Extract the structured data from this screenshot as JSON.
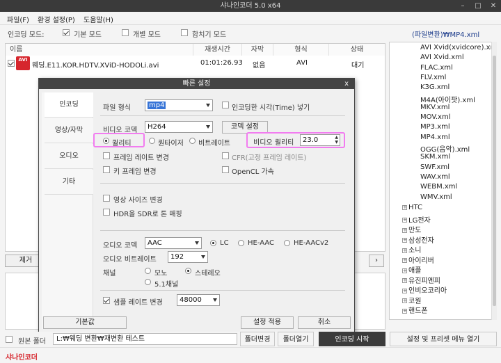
{
  "window": {
    "title": "샤나인코더  5.0 x64"
  },
  "menu": {
    "file": "파일(F)",
    "settings": "환경 설정(P)",
    "help": "도움말(H)"
  },
  "modes": {
    "label": "인코딩 모드:",
    "basic": "기본 모드",
    "individual": "개별 모드",
    "merge": "합치기 모드"
  },
  "preset_path": "(파일변환)₩MP4.xml",
  "filelist": {
    "headers": {
      "name": "이름",
      "duration": "재생시간",
      "subtitle": "자막",
      "format": "형식",
      "status": "상태"
    },
    "rows": [
      {
        "name": "웨딩.E11.KOR.HDTV.XViD-HODOLi.avi",
        "duration": "01:01:26.93",
        "subtitle": "없음",
        "format": "AVI",
        "status": "대기",
        "icon": "AVI"
      }
    ]
  },
  "remove_button": "제거",
  "tree": {
    "files": [
      "AVI Xvid(xvidcore).xml",
      "AVI Xvid.xml",
      "FLAC.xml",
      "FLV.xml",
      "K3G.xml",
      "M4A(아이팟).xml",
      "MKV.xml",
      "MOV.xml",
      "MP3.xml",
      "MP4.xml",
      "OGG(음악).xml",
      "SKM.xml",
      "SWF.xml",
      "WAV.xml",
      "WEBM.xml",
      "WMV.xml"
    ],
    "folders": [
      "HTC",
      "LG전자",
      "만도",
      "삼성전자",
      "소니",
      "아이리버",
      "애플",
      "유진피엔피",
      "인비오코리아",
      "코원",
      "핸드폰"
    ]
  },
  "dialog": {
    "title": "빠른 설정",
    "close": "x",
    "tabs": [
      "인코딩",
      "영상/자막",
      "오디오",
      "기타"
    ],
    "file_format_label": "파일 형식",
    "file_format": "mp4",
    "encoded_time_check": "인코딩한 시각(Time) 넣기",
    "video_codec_label": "비디오 코덱",
    "video_codec": "H264",
    "codec_settings_button": "코덱 설정",
    "rate_quality": "퀄리티",
    "rate_quantizer": "퀀타이저",
    "rate_bitrate": "비트레이트",
    "video_quality_label": "비디오 퀄리티",
    "video_quality": "23.0",
    "framerate_change": "프레임 레이트 변경",
    "cfr": "CFR(고정 프레임 레이트)",
    "keyframe_change": "키 프레임 변경",
    "opencl": "OpenCL 가속",
    "resize": "영상 사이즈 변경",
    "hdr_to_sdr": "HDR을 SDR로 톤 매핑",
    "audio_codec_label": "오디오 코덱",
    "audio_codec": "AAC",
    "aac_lc": "LC",
    "aac_he": "HE-AAC",
    "aac_hev2": "HE-AACv2",
    "audio_bitrate_label": "오디오 비트레이트",
    "audio_bitrate": "192",
    "channel_label": "채널",
    "mono": "모노",
    "stereo": "스테레오",
    "ch51": "5.1채널",
    "samplerate_change": "샘플 레이트 변경",
    "samplerate": "48000",
    "default_button": "기본값",
    "apply_button": "설정 적용",
    "cancel_button": "취소"
  },
  "bottom": {
    "source_folder_label": "원본 폴더",
    "output_path": "L:₩웨딩 변환₩재변환 테스트",
    "change_folder": "폴더변경",
    "open_folder": "폴더열기",
    "start_encoding": "인코딩 시작",
    "preset_menu": "설정 및 프리셋 메뉴 열기"
  },
  "status": {
    "brand": "샤나인코더"
  },
  "colors": {
    "highlight": "#f27cf0",
    "start_button": "#3b3b3b",
    "brand_red": "#d6262d",
    "preset_blue": "#1a3a8a",
    "selection": "#3875d7"
  }
}
